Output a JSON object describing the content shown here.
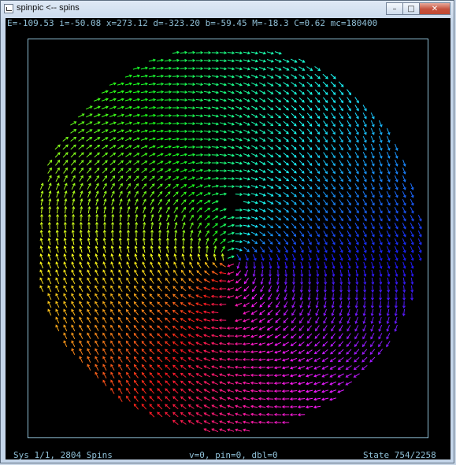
{
  "window": {
    "title": "spinpic <-- spins",
    "minimize_glyph": "–",
    "maximize_glyph": "□",
    "close_glyph": "✕"
  },
  "status": {
    "top": "E=-109.53 i=-50.08 x=273.12 d=-323.20 b=-59.45 M=-18.3 C=0.62 mc=180400",
    "bottom_left": "Sys 1/1, 2804 Spins",
    "bottom_middle": "v=0, pin=0, dbl=0",
    "bottom_right": "State 754/2258"
  },
  "colors": {
    "background": "#000000",
    "status_text": "#8fbfd6",
    "frame": "#8fbfd6"
  },
  "icons": [
    "app-icon",
    "minimize-icon",
    "maximize-icon",
    "close-icon"
  ]
}
